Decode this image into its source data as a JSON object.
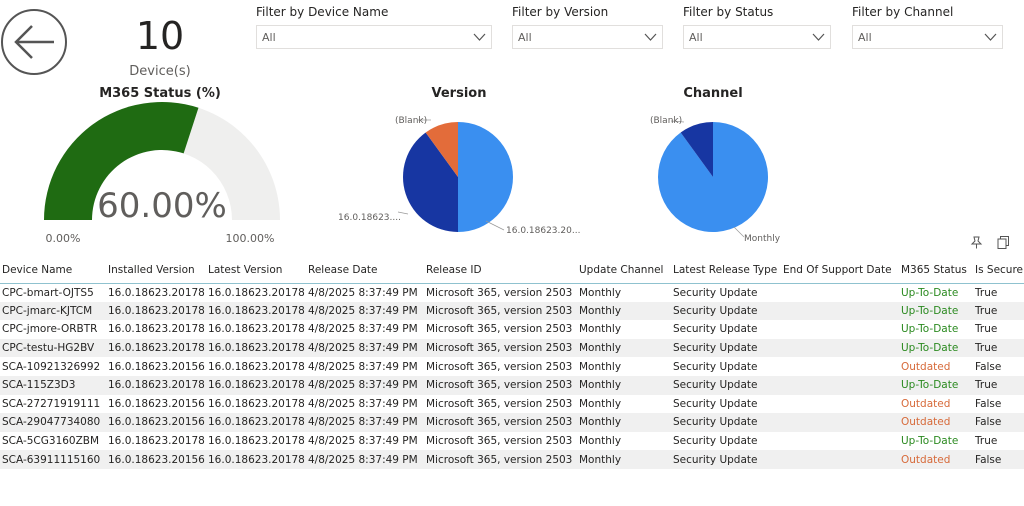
{
  "colors": {
    "gauge_fill": "#1f6b12",
    "gauge_track": "#efefee",
    "pie_primary": "#3a8ff0",
    "pie_secondary": "#1736a2",
    "pie_tertiary": "#e36c3a",
    "status_ok": "#2b8a20",
    "status_outdated": "#d76a3a"
  },
  "navigation": {
    "back_icon": "arrow-left-icon"
  },
  "device_card": {
    "value": "10",
    "label": "Device(s)"
  },
  "filters": [
    {
      "title": "Filter by Device Name",
      "value": "All"
    },
    {
      "title": "Filter by Version",
      "value": "All"
    },
    {
      "title": "Filter by Status",
      "value": "All"
    },
    {
      "title": "Filter by Channel",
      "value": "All"
    }
  ],
  "gauge": {
    "title": "M365 Status (%)",
    "value_label": "60.00%",
    "value": 60,
    "min_label": "0.00%",
    "max_label": "100.00%"
  },
  "version_chart": {
    "title": "Version",
    "slices": [
      {
        "label": "16.0.18623.20...",
        "value": 50
      },
      {
        "label": "16.0.18623....",
        "value": 40
      },
      {
        "label": "(Blank)",
        "value": 10
      }
    ]
  },
  "channel_chart": {
    "title": "Channel",
    "slices": [
      {
        "label": "Monthly",
        "value": 90
      },
      {
        "label": "(Blank)",
        "value": 10
      }
    ]
  },
  "visual_tools": {
    "pin_icon": "pin-icon",
    "copy_icon": "copy-icon"
  },
  "table": {
    "headers": [
      "Device Name",
      "Installed Version",
      "Latest Version",
      "Release Date",
      "Release ID",
      "Update Channel",
      "Latest Release Type",
      "End Of Support Date",
      "M365 Status",
      "Is Secure"
    ],
    "rows": [
      [
        "CPC-bmart-OJTS5",
        "16.0.18623.20178",
        "16.0.18623.20178",
        "4/8/2025 8:37:49 PM",
        "Microsoft 365, version 2503",
        "Monthly",
        "Security Update",
        "",
        "Up-To-Date",
        "True"
      ],
      [
        "CPC-jmarc-KJTCM",
        "16.0.18623.20178",
        "16.0.18623.20178",
        "4/8/2025 8:37:49 PM",
        "Microsoft 365, version 2503",
        "Monthly",
        "Security Update",
        "",
        "Up-To-Date",
        "True"
      ],
      [
        "CPC-jmore-ORBTR",
        "16.0.18623.20178",
        "16.0.18623.20178",
        "4/8/2025 8:37:49 PM",
        "Microsoft 365, version 2503",
        "Monthly",
        "Security Update",
        "",
        "Up-To-Date",
        "True"
      ],
      [
        "CPC-testu-HG2BV",
        "16.0.18623.20178",
        "16.0.18623.20178",
        "4/8/2025 8:37:49 PM",
        "Microsoft 365, version 2503",
        "Monthly",
        "Security Update",
        "",
        "Up-To-Date",
        "True"
      ],
      [
        "SCA-10921326992",
        "16.0.18623.20156",
        "16.0.18623.20178",
        "4/8/2025 8:37:49 PM",
        "Microsoft 365, version 2503",
        "Monthly",
        "Security Update",
        "",
        "Outdated",
        "False"
      ],
      [
        "SCA-115Z3D3",
        "16.0.18623.20178",
        "16.0.18623.20178",
        "4/8/2025 8:37:49 PM",
        "Microsoft 365, version 2503",
        "Monthly",
        "Security Update",
        "",
        "Up-To-Date",
        "True"
      ],
      [
        "SCA-27271919111",
        "16.0.18623.20156",
        "16.0.18623.20178",
        "4/8/2025 8:37:49 PM",
        "Microsoft 365, version 2503",
        "Monthly",
        "Security Update",
        "",
        "Outdated",
        "False"
      ],
      [
        "SCA-29047734080",
        "16.0.18623.20156",
        "16.0.18623.20178",
        "4/8/2025 8:37:49 PM",
        "Microsoft 365, version 2503",
        "Monthly",
        "Security Update",
        "",
        "Outdated",
        "False"
      ],
      [
        "SCA-5CG3160ZBM",
        "16.0.18623.20178",
        "16.0.18623.20178",
        "4/8/2025 8:37:49 PM",
        "Microsoft 365, version 2503",
        "Monthly",
        "Security Update",
        "",
        "Up-To-Date",
        "True"
      ],
      [
        "SCA-63911115160",
        "16.0.18623.20156",
        "16.0.18623.20178",
        "4/8/2025 8:37:49 PM",
        "Microsoft 365, version 2503",
        "Monthly",
        "Security Update",
        "",
        "Outdated",
        "False"
      ]
    ]
  }
}
